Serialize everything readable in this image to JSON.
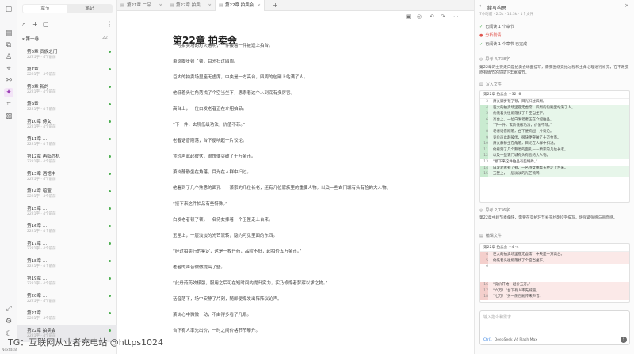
{
  "rail": {
    "icons": [
      "sidebar-toggle-icon",
      "book-icon",
      "outline-icon",
      "character-icon",
      "map-icon",
      "link-icon",
      "ai-icon",
      "plugin-icon",
      "note-icon"
    ],
    "glyphs": [
      "▢",
      "▤",
      "⧉",
      "♙",
      "⌖",
      "⚯",
      "✦",
      "⌗",
      "▨"
    ],
    "bottom_glyphs": [
      "⤢",
      "⚙",
      "☾"
    ],
    "version": "Nextdraft v1.1.1"
  },
  "sidebar": {
    "segments": [
      "章节",
      "笔记"
    ],
    "tool_glyphs": [
      "⌕",
      "+",
      "▢",
      "⋮"
    ],
    "volume": {
      "label": "第一卷",
      "count": "22"
    },
    "chapters": [
      {
        "title": "第6章 贵族之门",
        "meta": "2221字 · 4个前前"
      },
      {
        "title": "第7章 …",
        "meta": "2221字 · 4个前前"
      },
      {
        "title": "第8章 新的一",
        "meta": "2221字 · 4个前前"
      },
      {
        "title": "第9章 …",
        "meta": "2221字 · 4个前前"
      },
      {
        "title": "第10章 侍女",
        "meta": "2221字 · 4个前前"
      },
      {
        "title": "第11章 …",
        "meta": "2221字 · 4个前前"
      },
      {
        "title": "第12章 再临危机",
        "meta": "2221字 · 4个前前"
      },
      {
        "title": "第13章 酒馆中",
        "meta": "2221字 · 4个前前"
      },
      {
        "title": "第14章 暗室",
        "meta": "2221字 · 4个前前"
      },
      {
        "title": "第15章 …",
        "meta": "2221字 · 4个前前"
      },
      {
        "title": "第16章 …",
        "meta": "2221字 · 4个前前"
      },
      {
        "title": "第17章 …",
        "meta": "2221字 · 4个前前"
      },
      {
        "title": "第18章 …",
        "meta": "2221字 · 4个前前"
      },
      {
        "title": "第19章 …",
        "meta": "2221字 · 4个前前"
      },
      {
        "title": "第20章 …",
        "meta": "2221字 · 4个前前"
      },
      {
        "title": "第21章 …",
        "meta": "2221字 · 4个前前"
      },
      {
        "title": "第22章 拍卖会",
        "meta": "2221字 · 4个前前"
      }
    ]
  },
  "tabs": [
    {
      "label": "第21章 二品…"
    },
    {
      "label": "第22章 拍卖"
    },
    {
      "label": "第22章 拍卖会"
    }
  ],
  "tab_plus": "+",
  "editor": {
    "toolbar_glyphs": [
      "▣",
      "◎",
      "↶",
      "↷",
      "⋯"
    ],
    "title": "第22章 拍卖会",
    "paragraphs": [
      "一号拍卖场的灯火通明，一件接着一件被送上拍台。",
      "萧炎脚步顿了顿，目光扫过四周。",
      "巨大的拍卖场里座无虚席，中央是一方高台，四周的包厢上站满了人。",
      "他低着头往角落找了个空当坐下，思索着这个人到底有多厉害。",
      "高台上，一位白发老者正在介绍拍品。",
      "“下一件，玄阶低级功法，价值不菲。”",
      "老者话音刚落，台下便响起一片议论。",
      "竞价声此起彼伏，很快便突破了十万金币。",
      "萧炎静静坐在角落，目光在人群中扫过。",
      "他看到了几个熟悉的面孔——萧家的几位长老，还有几位家族里的重要人物。以及一些玄门城有头有脸的大人物。",
      "“接下来这件拍品有些特殊。”",
      "白发老者顿了顿，一名侍女捧着一个玉匣走上台来。",
      "玉匣上，一层淡淡的光芒流转，隐约可见里面的东西。",
      "“经过拍卖行的鉴定，这是一枚丹药，品阶不低，起拍价五万金币。”",
      "老者的声音微微提高了些。",
      "“此丹药药效极强，服用之后可在短时间内提升实力，实乃修炼者梦寐以求之物。”",
      "话音落下，场中安静了片刻，随即便爆发出阵阵议论声。",
      "萧炎心中微微一动，不由得多看了几眼。",
      "台下有人率先出价，一时之间价格节节攀升。"
    ]
  },
  "assistant": {
    "title": "续写构思",
    "meta": "7小时前 · 2.5k · 14.3k · 1个文件",
    "rows": [
      "已阅读 1 个章节",
      "分析剧情",
      "已阅读 1 个章节 已完成"
    ],
    "thinking": "思考 4,738字",
    "summary": "第22章的主要走向是拍卖会场面描写，需要围绕竞拍过程和主角心理进行补充，在不改变原有情节的前提下丰富细节。",
    "tag": "写入文件",
    "diff1": {
      "header": "第22章 拍卖会  +32 -8",
      "lines": [
        {
          "n": "3",
          "text": "萧炎脚步顿了顿，目光扫过四周。",
          "kind": "ctx"
        },
        {
          "n": "4",
          "text": "巨大的拍卖场里座无虚席，四周的包厢里站满了人。",
          "kind": "add"
        },
        {
          "n": "5",
          "text": "他低着头往角落找了个空当坐下。",
          "kind": "add"
        },
        {
          "n": "6",
          "text": "高台上，一位白发老者正在介绍拍品。",
          "kind": "add"
        },
        {
          "n": "7",
          "text": "“下一件，玄阶低级功法，价值不菲。”",
          "kind": "add"
        },
        {
          "n": "8",
          "text": "老者话音刚落，台下便响起一片议论。",
          "kind": "add"
        },
        {
          "n": "9",
          "text": "竞价声此起彼伏，很快便突破了十万金币。",
          "kind": "add"
        },
        {
          "n": "10",
          "text": "萧炎静静坐在角落，目光在人群中扫过。",
          "kind": "add"
        },
        {
          "n": "11",
          "text": "他看到了几个熟悉的面孔——萧家的几位长老。",
          "kind": "add"
        },
        {
          "n": "12",
          "text": "以及一些玄门城有头有脸的大人物。",
          "kind": "add"
        },
        {
          "n": "13",
          "text": "“接下来这件拍品有些特殊。”",
          "kind": "ctx"
        },
        {
          "n": "14",
          "text": "白发老者顿了顿，一名侍女捧着玉匣走上台来。",
          "kind": "add"
        },
        {
          "n": "15",
          "text": "玉匣上，一层淡淡的光芒流转。",
          "kind": "add"
        }
      ]
    },
    "thinking2": "思考 2,736字",
    "summary2": "第22章中段节奏偏快，需要在竞拍环节补充约800字描写，增强紧张感与画面感。",
    "tag2": "编辑文件",
    "diff2": {
      "header": "第22章 拍卖会  +4 -4",
      "lines": [
        {
          "n": "4",
          "text": "巨大的拍卖场里座无虚席，中央是一方高台。",
          "kind": "del"
        },
        {
          "n": "5",
          "text": "他低着头往角落找了个空当坐下。",
          "kind": "del"
        },
        {
          "n": "6",
          "text": "",
          "kind": "ctx"
        },
        {
          "n": "",
          "text": "",
          "kind": "ctx"
        },
        {
          "n": "",
          "text": "",
          "kind": "ctx"
        },
        {
          "n": "16",
          "text": "“竞价开始！起价五万。”",
          "kind": "del"
        },
        {
          "n": "17",
          "text": "“六万！”台下有人率先喊道。",
          "kind": "del"
        },
        {
          "n": "18",
          "text": "“七万！”另一侧包厢传来声音。",
          "kind": "del"
        }
      ]
    },
    "input_placeholder": "输入指令和需求...",
    "model": "DeepSeek V4 Flash  Max",
    "mode": "Ctrl1",
    "send_glyph": "↑"
  },
  "watermark": "TG：互联网从业者充电站 @https1024",
  "colors": {
    "accent": "#9b3fb5",
    "add_bg": "#e7f6ea",
    "del_bg": "#fbe9e8",
    "done": "#4caf50"
  }
}
